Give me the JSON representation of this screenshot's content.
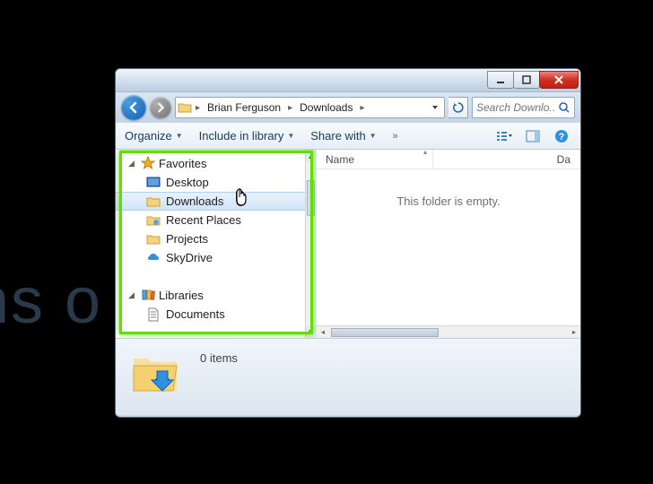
{
  "background_text": "ns o",
  "breadcrumb": {
    "seg1": "Brian Ferguson",
    "seg2": "Downloads"
  },
  "search": {
    "placeholder": "Search Downlo..."
  },
  "toolbar": {
    "organize": "Organize",
    "include": "Include in library",
    "share": "Share with"
  },
  "nav": {
    "favorites": "Favorites",
    "desktop": "Desktop",
    "downloads": "Downloads",
    "recent": "Recent Places",
    "projects": "Projects",
    "skydrive": "SkyDrive",
    "libraries": "Libraries",
    "documents": "Documents"
  },
  "columns": {
    "name": "Name",
    "date": "Da"
  },
  "empty_message": "This folder is empty.",
  "status": {
    "items": "0 items"
  }
}
